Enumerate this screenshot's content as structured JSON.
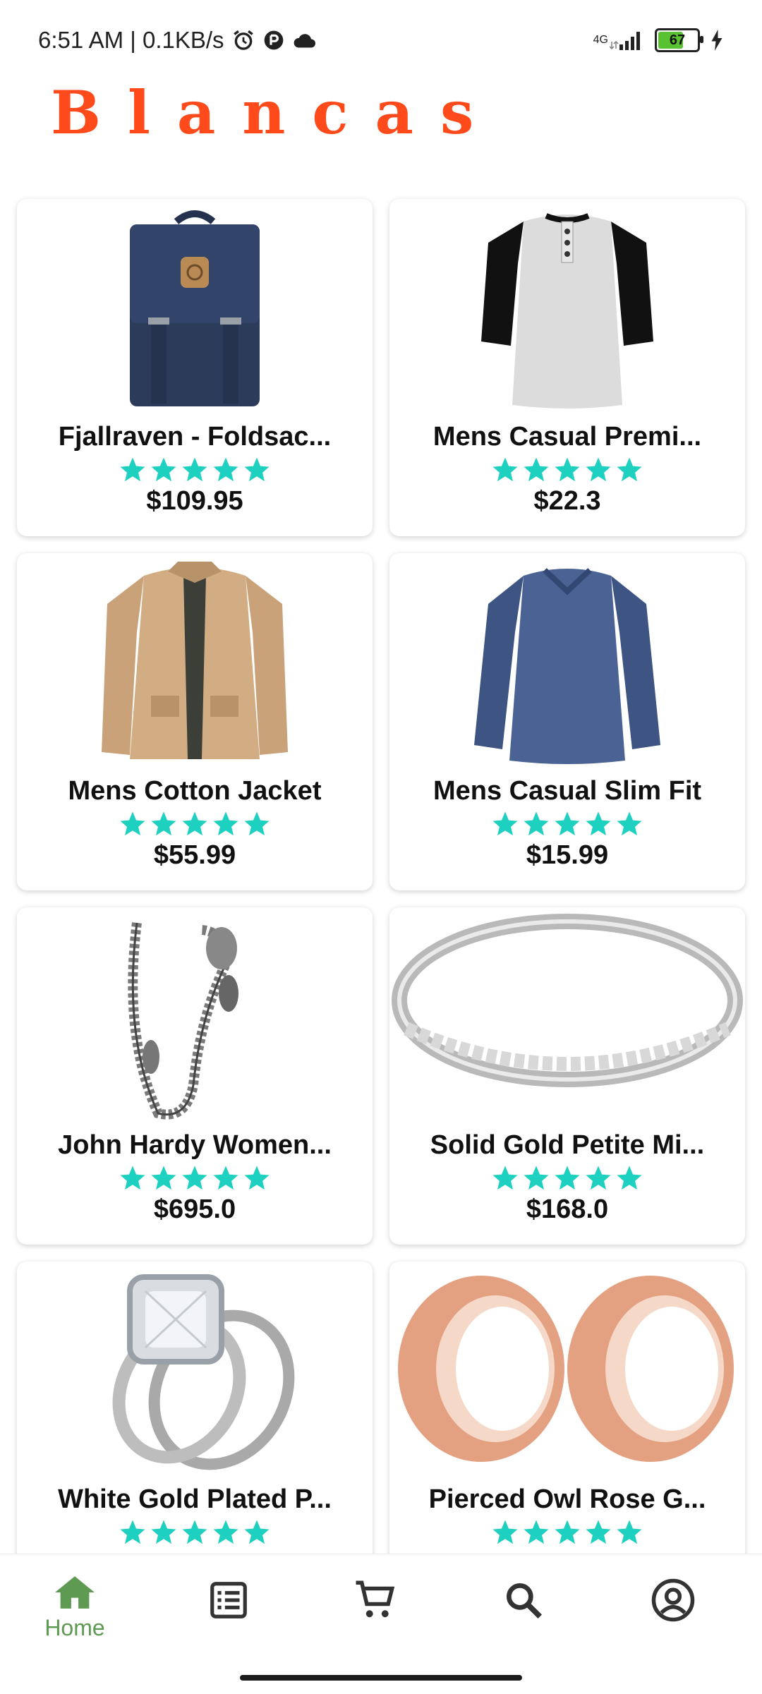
{
  "status_bar": {
    "time_speed": "6:51 AM | 0.1KB/s",
    "network": "4G",
    "battery_level": "67",
    "icons": [
      "alarm-icon",
      "privacy-icon",
      "cloud-icon",
      "signal-icon",
      "battery-icon",
      "charging-icon"
    ]
  },
  "brand": {
    "name": "Blancas",
    "color": "#ff4a1c"
  },
  "products": [
    {
      "title": "Fjallraven - Foldsac...",
      "price": "$109.95",
      "rating": 5,
      "image": "backpack"
    },
    {
      "title": "Mens Casual Premi...",
      "price": "$22.3",
      "rating": 5,
      "image": "henley-shirt"
    },
    {
      "title": "Mens Cotton Jacket",
      "price": "$55.99",
      "rating": 5,
      "image": "jacket"
    },
    {
      "title": "Mens Casual Slim Fit",
      "price": "$15.99",
      "rating": 5,
      "image": "long-sleeve-tee"
    },
    {
      "title": "John Hardy Women...",
      "price": "$695.0",
      "rating": 5,
      "image": "chain-bracelet"
    },
    {
      "title": "Solid Gold Petite Mi...",
      "price": "$168.0",
      "rating": 5,
      "image": "gold-ring"
    },
    {
      "title": "White Gold Plated P...",
      "price": "",
      "rating": 5,
      "image": "diamond-ring"
    },
    {
      "title": "Pierced Owl Rose G...",
      "price": "",
      "rating": 5,
      "image": "ear-tunnels"
    }
  ],
  "bottom_nav": {
    "items": [
      {
        "label": "Home",
        "icon": "home-icon",
        "active": true
      },
      {
        "label": "",
        "icon": "list-icon",
        "active": false
      },
      {
        "label": "",
        "icon": "cart-icon",
        "active": false
      },
      {
        "label": "",
        "icon": "search-icon",
        "active": false
      },
      {
        "label": "",
        "icon": "account-icon",
        "active": false
      }
    ]
  },
  "colors": {
    "star": "#1ed0c0",
    "nav_active": "#5e9a52",
    "nav_inactive": "#333333"
  }
}
